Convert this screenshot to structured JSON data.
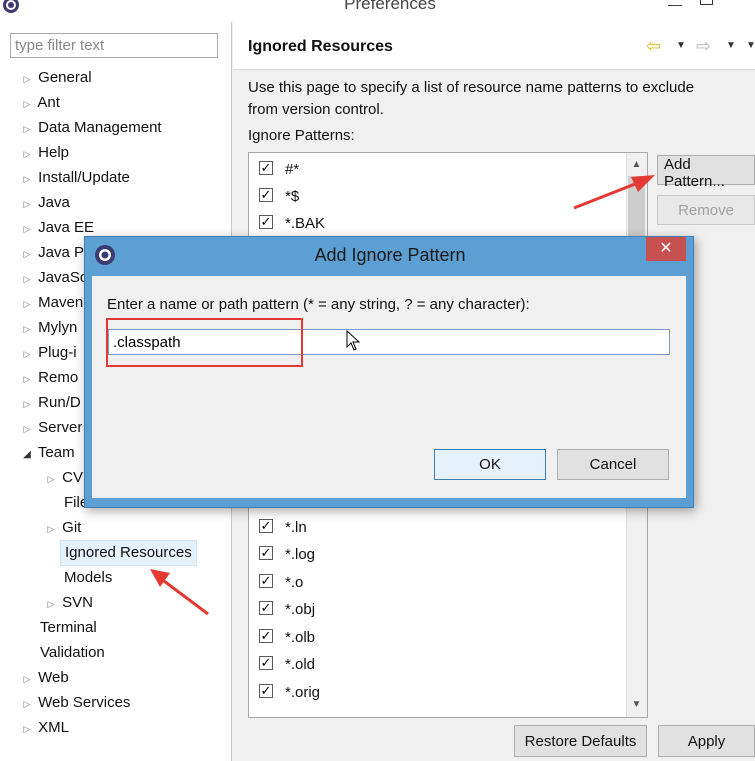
{
  "window": {
    "title": "Preferences"
  },
  "filter": {
    "placeholder": "type filter text"
  },
  "tree": {
    "items": [
      {
        "label": "General"
      },
      {
        "label": "Ant"
      },
      {
        "label": "Data Management"
      },
      {
        "label": "Help"
      },
      {
        "label": "Install/Update"
      },
      {
        "label": "Java"
      },
      {
        "label": "Java EE"
      },
      {
        "label": "Java P"
      },
      {
        "label": "JavaSc"
      },
      {
        "label": "Maven"
      },
      {
        "label": "Mylyn"
      },
      {
        "label": "Plug-i"
      },
      {
        "label": "Remo"
      },
      {
        "label": "Run/D"
      },
      {
        "label": "Server"
      },
      {
        "label": "Team"
      },
      {
        "label": "CV"
      },
      {
        "label": "File"
      },
      {
        "label": "Git"
      },
      {
        "label": "Ignored Resources"
      },
      {
        "label": "Models"
      },
      {
        "label": "SVN"
      },
      {
        "label": "Terminal"
      },
      {
        "label": "Validation"
      },
      {
        "label": "Web"
      },
      {
        "label": "Web Services"
      },
      {
        "label": "XML"
      }
    ]
  },
  "page": {
    "title": "Ignored Resources",
    "description_line1": "Use this page to specify a list of resource name patterns to exclude",
    "description_line2": "from version control.",
    "patterns_label": "Ignore Patterns:",
    "patterns": [
      "#*",
      "*$",
      "*.BAK",
      "*.ln",
      "*.log",
      "*.o",
      "*.obj",
      "*.olb",
      "*.old",
      "*.orig"
    ],
    "add_button": "Add Pattern...",
    "remove_button": "Remove",
    "restore_defaults_button": "Restore Defaults",
    "apply_button": "Apply"
  },
  "dialog": {
    "title": "Add Ignore Pattern",
    "prompt": "Enter a name or path pattern (* = any string, ? = any character):",
    "input_value": ".classpath",
    "ok_button": "OK",
    "cancel_button": "Cancel",
    "close_glyph": "✕"
  },
  "icons": {
    "app": "eclipse-icon",
    "back": "back-arrow-icon",
    "forward": "forward-arrow-icon",
    "checkbox_checked": "✓"
  },
  "colors": {
    "dialog_frame": "#5b9fd3",
    "close_button": "#c75050",
    "annotation": "#e53935",
    "back_arrow": "#e8b830"
  }
}
